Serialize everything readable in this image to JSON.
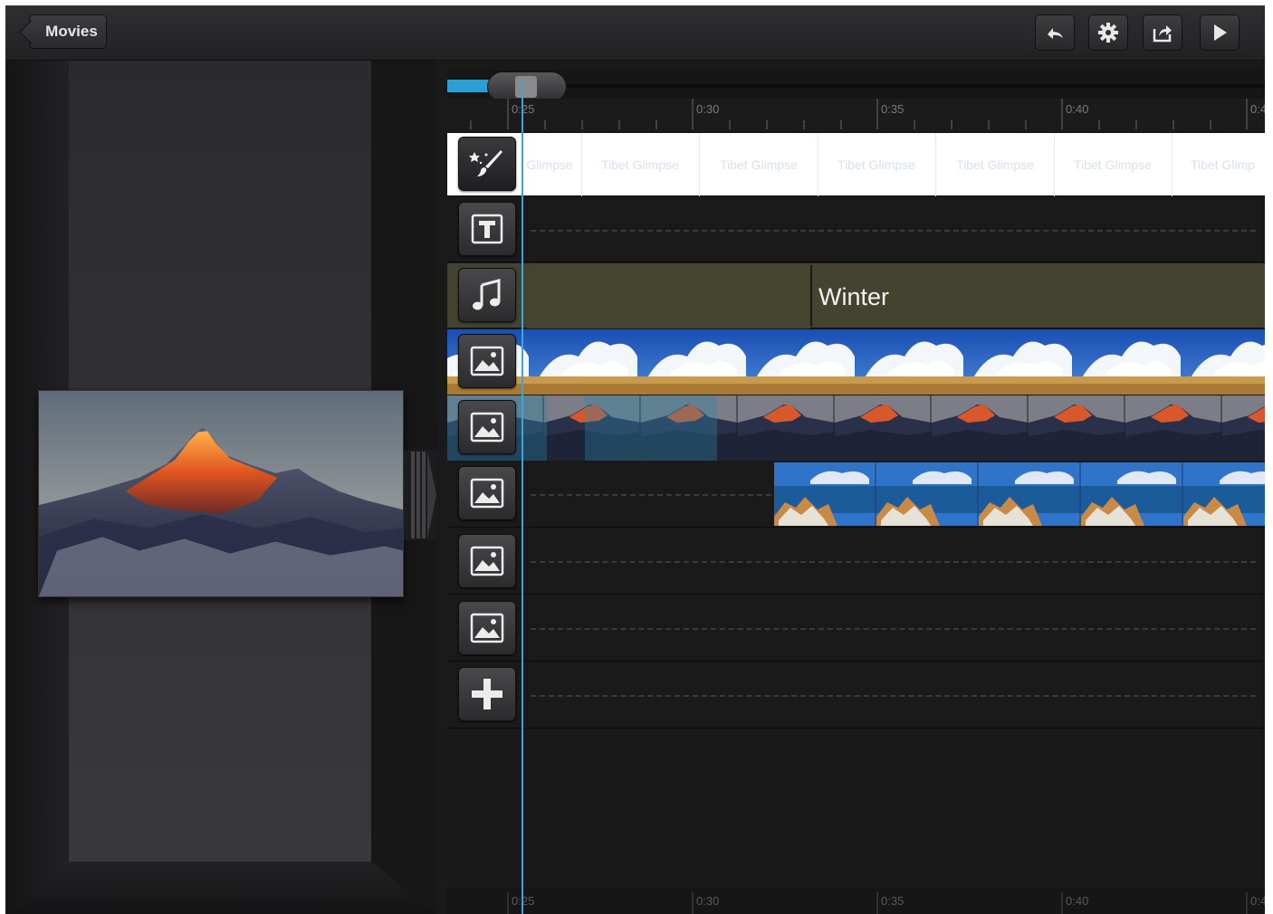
{
  "toolbar": {
    "back_label": "Movies",
    "buttons": [
      "undo-icon",
      "gear-icon",
      "share-icon",
      "play-icon"
    ]
  },
  "timeline": {
    "top_ruler_labels": [
      "0:25",
      "0:30",
      "0:35",
      "0:40",
      "0:4"
    ],
    "bottom_ruler_labels": [
      "0:25",
      "0:30",
      "0:35",
      "0:40",
      "0:4"
    ],
    "theme_cells": [
      "Glimpse",
      "Tibet Glimpse",
      "Tibet Glimpse",
      "Tibet Glimpse",
      "Tibet Glimpse",
      "Tibet Glimpse",
      "Tibet Glimp"
    ],
    "music_title": "Winter",
    "tracks": [
      "theme-track",
      "title-track",
      "music-track",
      "image-track-1",
      "image-track-2",
      "image-track-3",
      "image-track-4",
      "image-track-5",
      "add-track"
    ]
  },
  "colors": {
    "accent": "#2a9fd6",
    "music_track": "#434330",
    "theme_track": "#ffffff"
  }
}
